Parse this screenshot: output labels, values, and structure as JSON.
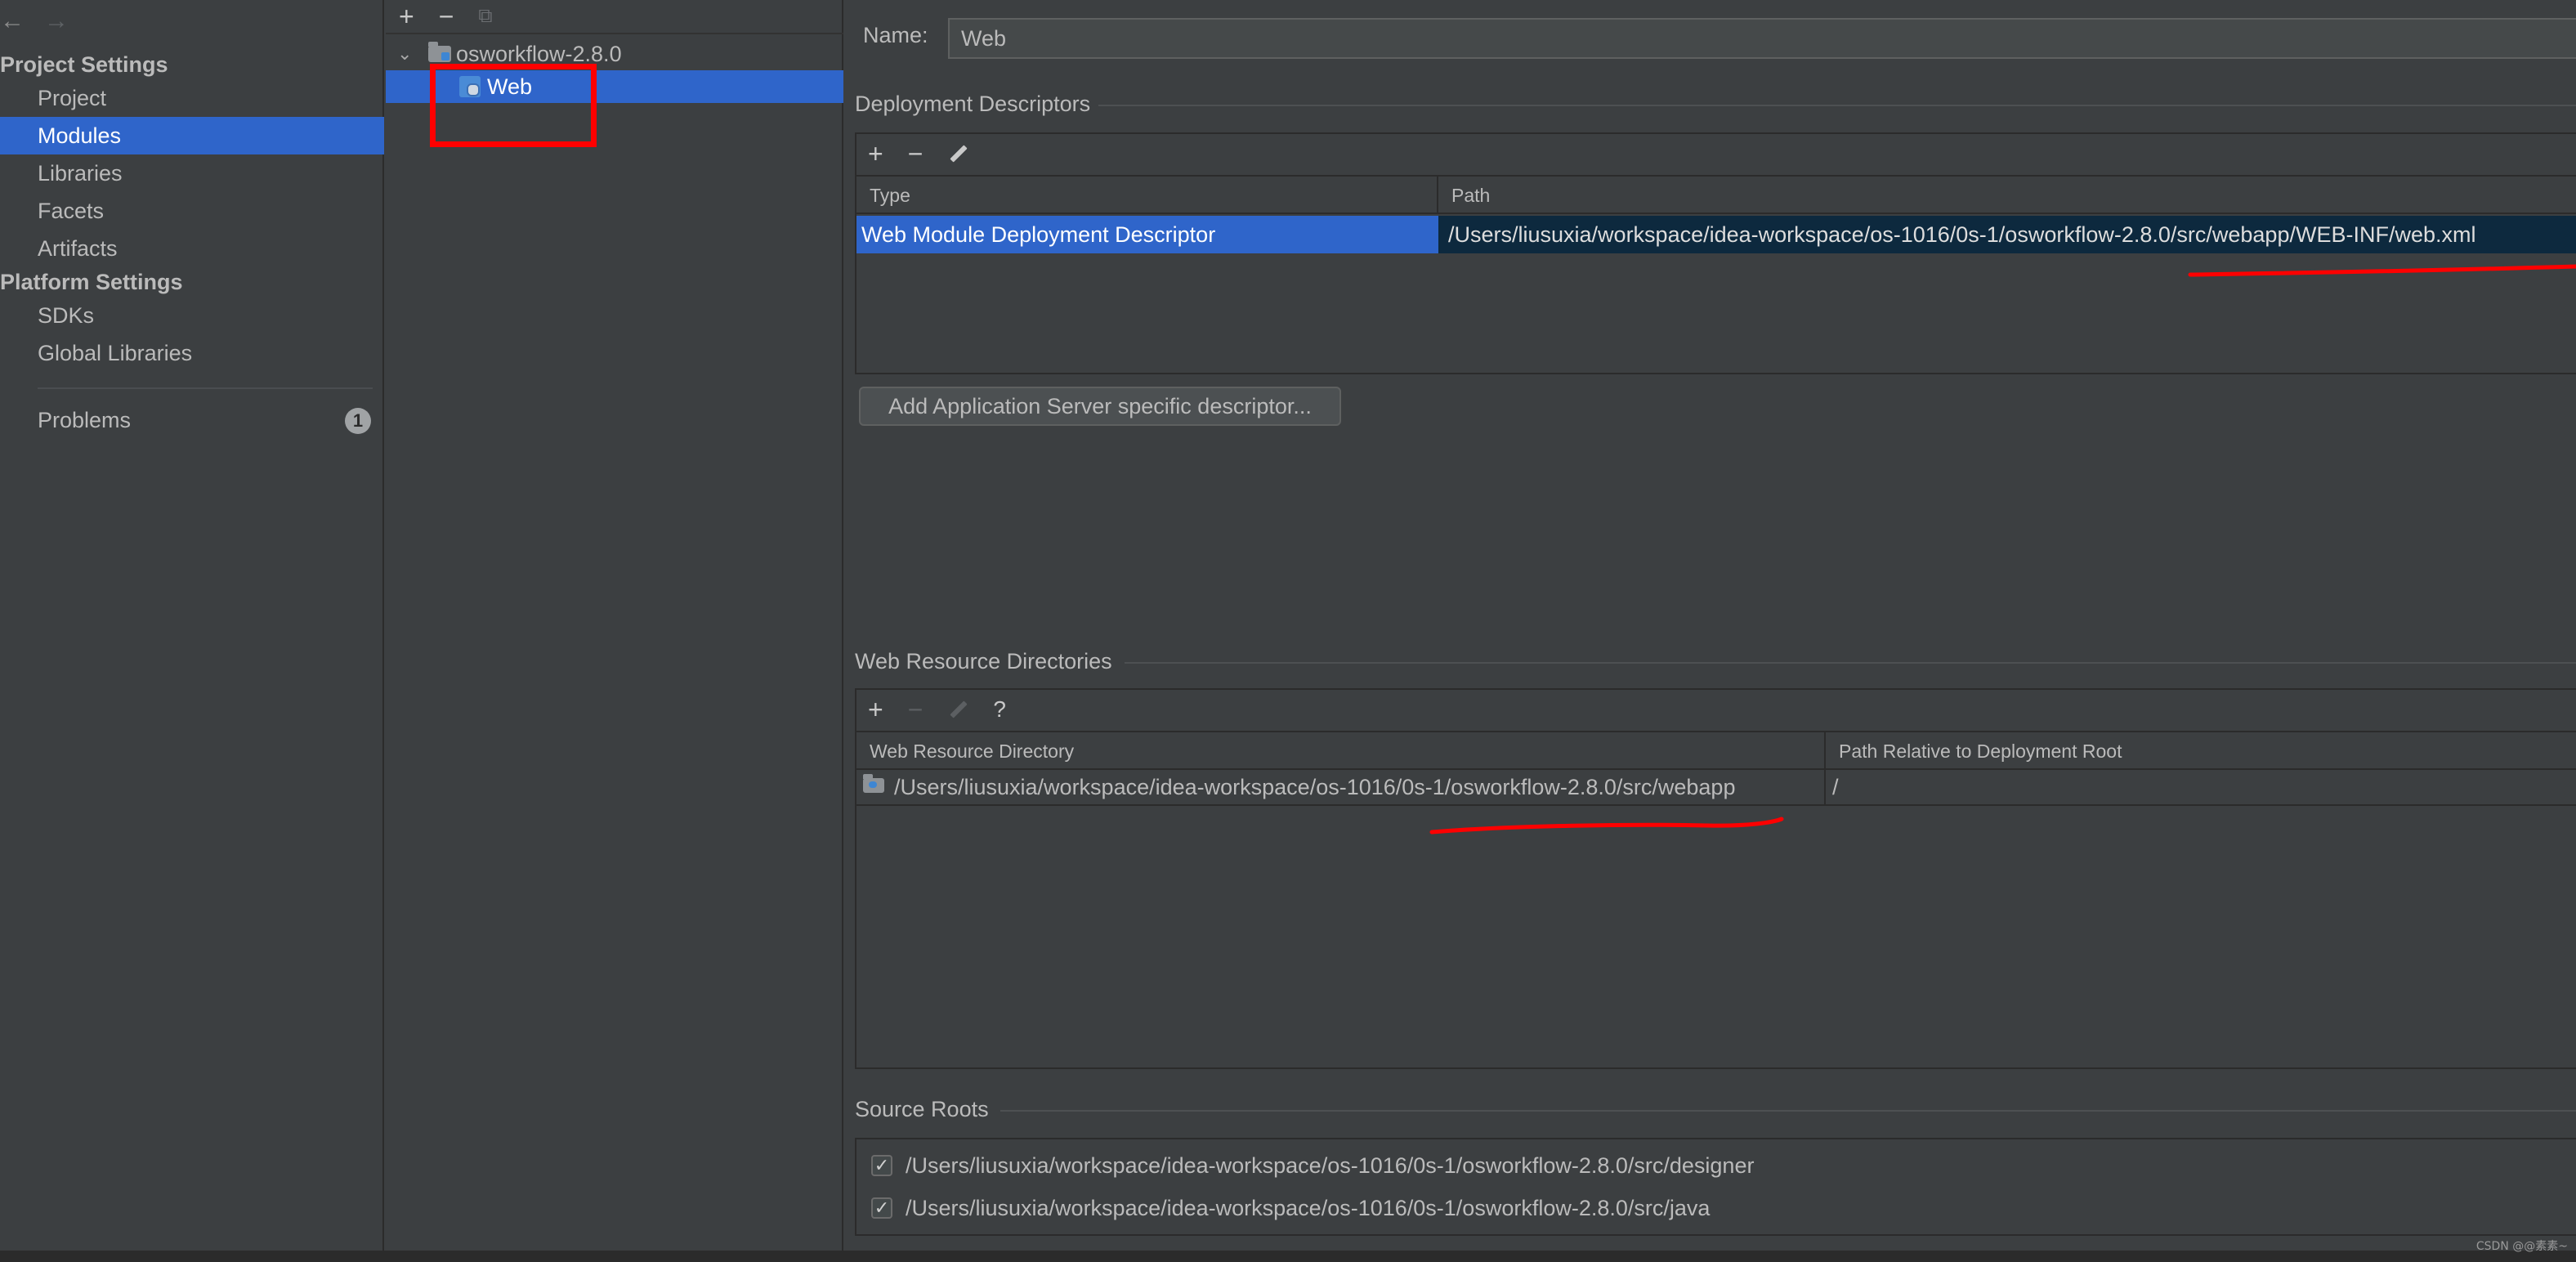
{
  "nav": {
    "back": "←",
    "forward": "→"
  },
  "sidebar": {
    "project_settings_title": "Project Settings",
    "platform_settings_title": "Platform Settings",
    "items": [
      {
        "label": "Project"
      },
      {
        "label": "Modules"
      },
      {
        "label": "Libraries"
      },
      {
        "label": "Facets"
      },
      {
        "label": "Artifacts"
      },
      {
        "label": "SDKs"
      },
      {
        "label": "Global Libraries"
      }
    ],
    "problems": {
      "label": "Problems",
      "count": "1"
    }
  },
  "tree": {
    "toolbar": {
      "add": "+",
      "remove": "−",
      "copy": "⧉"
    },
    "root": {
      "label": "osworkflow-2.8.0",
      "chevron": "⌄"
    },
    "child": {
      "label": "Web"
    }
  },
  "main": {
    "name_label": "Name:",
    "name_value": "Web",
    "deployment": {
      "title": "Deployment Descriptors",
      "toolbar": {
        "add": "+",
        "remove": "−"
      },
      "columns": [
        "Type",
        "Path"
      ],
      "rows": [
        {
          "type": "Web Module Deployment Descriptor",
          "path": "/Users/liusuxia/workspace/idea-workspace/os-1016/0s-1/osworkflow-2.8.0/src/webapp/WEB-INF/web.xml"
        }
      ],
      "add_button": "Add Application Server specific descriptor..."
    },
    "web_resources": {
      "title": "Web Resource Directories",
      "toolbar": {
        "add": "+",
        "remove": "−",
        "help": "?"
      },
      "columns": [
        "Web Resource Directory",
        "Path Relative to Deployment Root"
      ],
      "rows": [
        {
          "directory": "/Users/liusuxia/workspace/idea-workspace/os-1016/0s-1/osworkflow-2.8.0/src/webapp",
          "relative": "/"
        }
      ]
    },
    "source_roots": {
      "title": "Source Roots",
      "items": [
        {
          "checked": "✓",
          "path": "/Users/liusuxia/workspace/idea-workspace/os-1016/0s-1/osworkflow-2.8.0/src/designer"
        },
        {
          "checked": "✓",
          "path": "/Users/liusuxia/workspace/idea-workspace/os-1016/0s-1/osworkflow-2.8.0/src/java"
        }
      ]
    }
  },
  "watermark": "CSDN @@素素~",
  "colors": {
    "selection": "#2f65ca",
    "annotation": "#ff0000",
    "background": "#3c3f41"
  }
}
